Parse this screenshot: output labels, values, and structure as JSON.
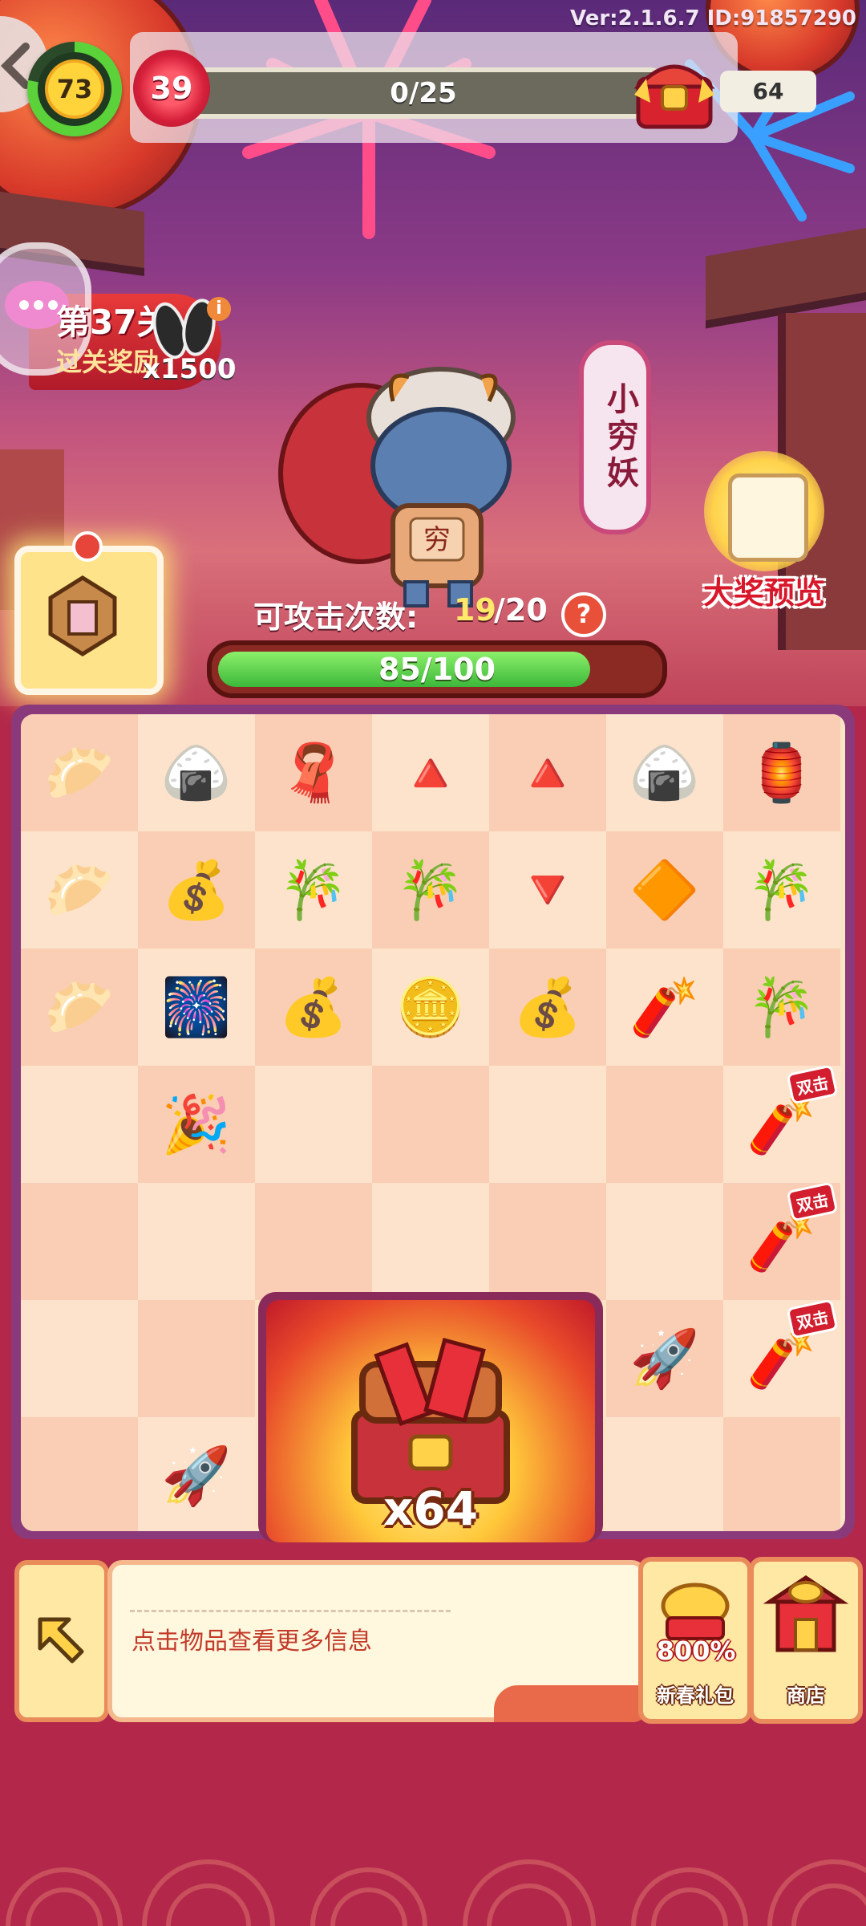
{
  "header": {
    "version": "Ver:2.1.6.7 ID:91857290",
    "player_level": "73",
    "flower_level": "39",
    "progress_text": "0/25",
    "progress_fraction": 0.0,
    "chest_count": "64"
  },
  "stage": {
    "title": "第37关",
    "subtitle": "过关奖励",
    "reward_count": "x1500",
    "info_icon": "info-icon"
  },
  "monster": {
    "name": "小穷妖",
    "shirt_text": "穷"
  },
  "grand_prize": {
    "label": "大奖预览"
  },
  "attack": {
    "label": "可攻击次数:",
    "value": "19",
    "max": "/20",
    "help": "?"
  },
  "hp": {
    "text": "85/100",
    "fraction": 0.85
  },
  "board": {
    "rows": [
      [
        "dumplings",
        "rice-sack",
        "red-cloth",
        "red-paper-fold",
        "red-paper-cone",
        "rice-sack",
        "lantern-frame"
      ],
      [
        "dumpling",
        "gold-ingots",
        "bamboo-cube",
        "bamboo-frame",
        "red-paper-triangle",
        "red-diamond-paper",
        "bamboo-shoot"
      ],
      [
        "dumpling-plate",
        "firework-rockets",
        "gold-ingot",
        "gold-coin",
        "gold-ingot",
        "firecracker",
        "bamboo-shoot"
      ],
      [
        "",
        "party-hat",
        "",
        "",
        "",
        "",
        "firecracker-roll"
      ],
      [
        "",
        "",
        "",
        "",
        "",
        "",
        "firecracker-roll"
      ],
      [
        "",
        "",
        "",
        "",
        "",
        "purple-rocket",
        "firecracker-roll"
      ],
      [
        "",
        "purple-rocket",
        "",
        "",
        "",
        "",
        ""
      ]
    ],
    "double_tag": "双击"
  },
  "big_chest": {
    "count": "x64"
  },
  "bottom": {
    "hint": "点击物品查看更多信息",
    "gift_pct": "800%",
    "gift_label": "新春礼包",
    "shop_label": "商店"
  },
  "colors": {
    "accent_red": "#d21e2e",
    "hp_green": "#3cb83a",
    "board_frame": "#8a3a7a",
    "cell_light": "#fde3cc",
    "cell_dark": "#f9ceb4"
  }
}
